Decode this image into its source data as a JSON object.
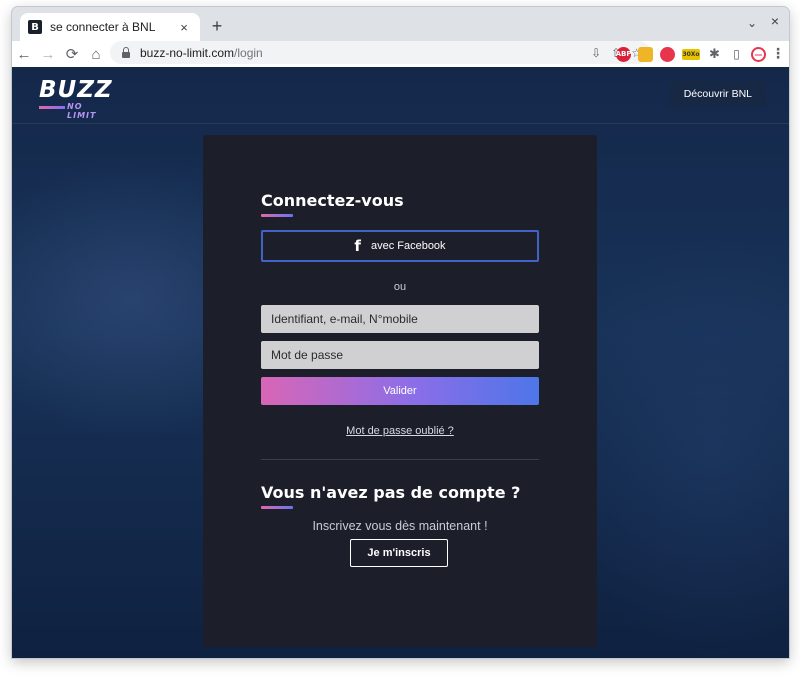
{
  "browser": {
    "tab_title": "se connecter à BNL",
    "tab_favicon": "B",
    "tab_close_icon": "×",
    "new_tab_icon": "+",
    "tab_search_icon": "⌄",
    "window_close_icon": "×",
    "url_host": "buzz-no-limit.com",
    "url_path": "/login",
    "nav": {
      "back_icon": "←",
      "forward_icon": "→",
      "reload_icon": "⟳",
      "home_icon": "⌂"
    },
    "omnibox_icons": {
      "install_icon": "⇩",
      "share_icon": "⇧",
      "bookmark_icon": "☆"
    },
    "extensions": {
      "abp": "ABP",
      "counter_badge": "30Xo",
      "puzzle_icon": "✱",
      "sidepanel_icon": "▯",
      "menu_icon": "⋮"
    }
  },
  "header": {
    "logo_main": "BUZZ",
    "logo_sub": "NO LIMIT",
    "discover_button": "Découvrir BNL"
  },
  "login": {
    "title": "Connectez-vous",
    "facebook_icon": "f",
    "facebook_button": "avec Facebook",
    "or_label": "ou",
    "identifier_placeholder": "Identifiant, e-mail, N°mobile",
    "password_placeholder": "Mot de passe",
    "submit_button": "Valider",
    "forgot_link": "Mot de passe oublié ?"
  },
  "signup": {
    "title": "Vous n'avez pas de compte ?",
    "subtitle": "Inscrivez vous dès maintenant !",
    "button": "Je m'inscris"
  },
  "colors": {
    "page_bg": "#14284a",
    "card_bg": "#1c1f2a",
    "facebook_border": "#3f63c6",
    "gradient_start": "#d866b6",
    "gradient_end": "#4d76e8",
    "input_bg": "#d0d0d3"
  }
}
